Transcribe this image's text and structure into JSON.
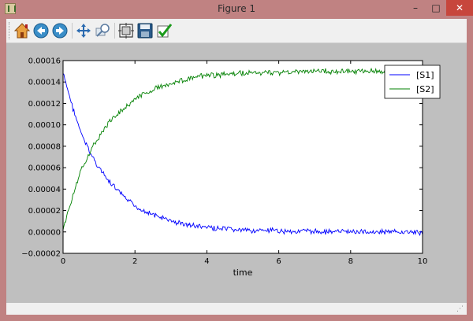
{
  "window": {
    "title": "Figure 1",
    "min_glyph": "–",
    "max_glyph": "□",
    "close_glyph": "✕"
  },
  "toolbar": {
    "buttons": [
      {
        "name": "home-icon",
        "label": "Home"
      },
      {
        "name": "back-icon",
        "label": "Back"
      },
      {
        "name": "forward-icon",
        "label": "Forward"
      },
      {
        "name": "pan-icon",
        "label": "Pan"
      },
      {
        "name": "zoom-icon",
        "label": "Zoom"
      },
      {
        "name": "subplots-icon",
        "label": "Subplots"
      },
      {
        "name": "save-icon",
        "label": "Save"
      },
      {
        "name": "edit-icon",
        "label": "Customize"
      }
    ]
  },
  "colors": {
    "s1": "#0000ff",
    "s2": "#008000",
    "figure_bg": "#bfbfbf",
    "axes_bg": "#ffffff"
  },
  "chart_data": {
    "type": "line",
    "title": "",
    "xlabel": "time",
    "ylabel": "",
    "xlim": [
      0,
      10
    ],
    "ylim": [
      -2e-05,
      0.00016
    ],
    "xticks": [
      0,
      2,
      4,
      6,
      8,
      10
    ],
    "xtick_labels": [
      "0",
      "2",
      "4",
      "6",
      "8",
      "10"
    ],
    "yticks": [
      -2e-05,
      0,
      2e-05,
      4e-05,
      6e-05,
      8e-05,
      0.0001,
      0.00012,
      0.00014,
      0.00016
    ],
    "ytick_labels": [
      "−0.00002",
      "0.00000",
      "0.00002",
      "0.00004",
      "0.00006",
      "0.00008",
      "0.00010",
      "0.00012",
      "0.00014",
      "0.00016"
    ],
    "legend_position": "top-right",
    "series": [
      {
        "name": "[S1]",
        "color": "#0000ff",
        "x": [
          0,
          0.25,
          0.5,
          0.75,
          1.0,
          1.25,
          1.5,
          1.75,
          2.0,
          2.5,
          3.0,
          3.5,
          4.0,
          4.5,
          5.0,
          6.0,
          7.0,
          8.0,
          9.0,
          10.0
        ],
        "values": [
          0.000148,
          0.000118,
          9.2e-05,
          7.4e-05,
          6e-05,
          4.8e-05,
          3.9e-05,
          3.1e-05,
          2.4e-05,
          1.6e-05,
          1e-05,
          6.5e-06,
          4e-06,
          2.5e-06,
          1.5e-06,
          8e-07,
          4e-07,
          2e-07,
          0.0,
          -5e-07
        ]
      },
      {
        "name": "[S2]",
        "color": "#008000",
        "x": [
          0,
          0.25,
          0.5,
          0.75,
          1.0,
          1.25,
          1.5,
          1.75,
          2.0,
          2.5,
          3.0,
          3.5,
          4.0,
          4.5,
          5.0,
          6.0,
          7.0,
          8.0,
          9.0,
          10.0
        ],
        "values": [
          2e-06,
          3.2e-05,
          5.7e-05,
          7.5e-05,
          8.9e-05,
          0.000101,
          0.00011,
          0.000117,
          0.000124,
          0.000133,
          0.000139,
          0.000143,
          0.000146,
          0.000147,
          0.000148,
          0.000149,
          0.00015,
          0.00015,
          0.00015,
          0.00015
        ]
      }
    ]
  }
}
